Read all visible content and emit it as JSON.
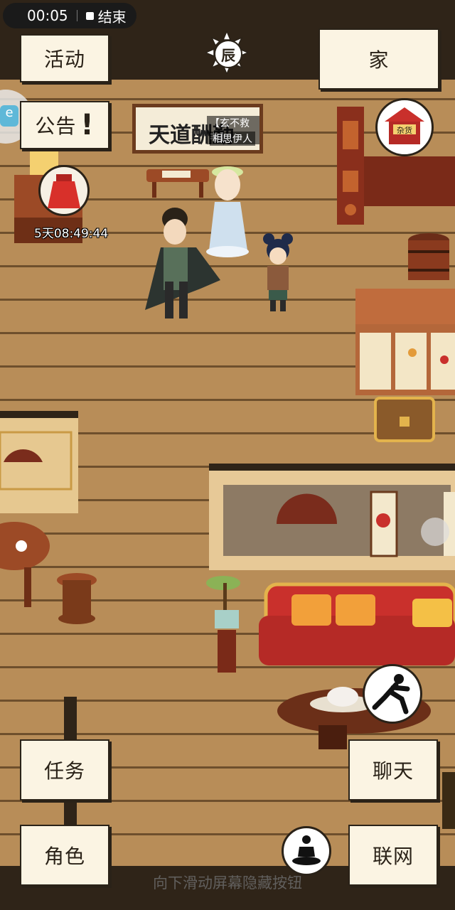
{
  "status_bar": {
    "time": "00:05",
    "end_label": "结束"
  },
  "top_buttons": {
    "activity": "活动",
    "home": "家",
    "notice": "公告"
  },
  "time_emblem": "辰",
  "sign": {
    "title": "天道酬勤",
    "tag_line1": "【玄不救非】",
    "tag_line2": "相思伊人"
  },
  "gift": {
    "countdown": "5天08:49:44"
  },
  "shop_label": "杂货",
  "bottom_buttons": {
    "task": "任务",
    "role": "角色",
    "chat": "聊天",
    "network": "联网"
  },
  "hint_text": "向下滑动屏幕隐藏按钮",
  "colors": {
    "floor": "#b88d58",
    "wall": "#2f2418",
    "button_bg": "#fbf4e3",
    "sofa": "#c9302c"
  }
}
